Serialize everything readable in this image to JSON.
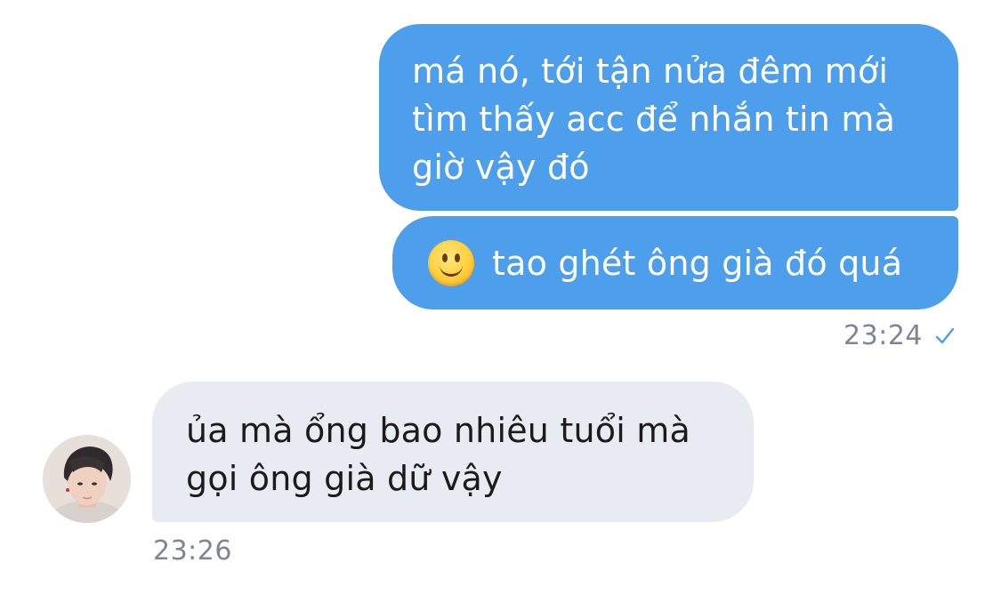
{
  "conversation": {
    "sent_group": {
      "message_1": "má nó, tới tận nửa đêm mới tìm thấy acc để nhắn tin mà giờ vậy đó",
      "message_2_emoji": "slightly-smiling-face",
      "message_2": "tao ghét ông già đó quá",
      "timestamp": "23:24",
      "status_icon": "checkmark-icon"
    },
    "received_group": {
      "message_1": "ủa mà ổng bao nhiêu tuổi mà gọi ông già dữ vậy",
      "timestamp": "23:26",
      "avatar": "contact-avatar"
    }
  },
  "colors": {
    "sent_bubble": "#4d9fec",
    "received_bubble": "#e8ebf1",
    "timestamp": "#7d8793",
    "check": "#4d9fec"
  }
}
